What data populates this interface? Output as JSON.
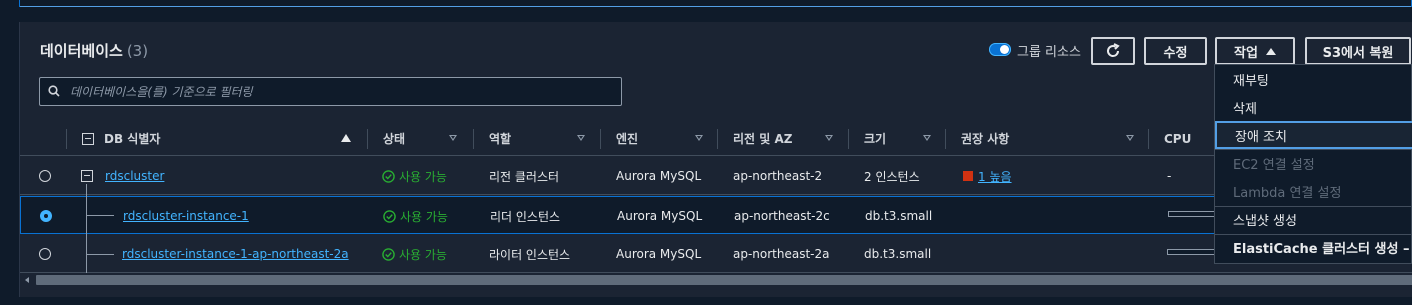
{
  "header": {
    "title": "데이터베이스",
    "count": "(3)",
    "group_toggle_label": "그룹 리소스",
    "group_toggle_on": true,
    "edit_label": "수정",
    "actions_label": "작업",
    "restore_label": "S3에서 복원"
  },
  "filter": {
    "placeholder": "데이터베이스을(를) 기준으로 필터링"
  },
  "columns": {
    "db_id": "DB 식별자",
    "status": "상태",
    "role": "역할",
    "engine": "엔진",
    "region": "리전 및 AZ",
    "size": "크기",
    "recommendations": "권장 사항",
    "cpu": "CPU"
  },
  "rows": [
    {
      "id": "rdscluster",
      "status": "사용 가능",
      "role": "리전 클러스터",
      "engine": "Aurora MySQL",
      "region": "ap-northeast-2",
      "size": "2 인스턴스",
      "recommendation": "1 높음",
      "cpu": "-",
      "selected": false
    },
    {
      "id": "rdscluster-instance-1",
      "status": "사용 가능",
      "role": "리더 인스턴스",
      "engine": "Aurora MySQL",
      "region": "ap-northeast-2c",
      "size": "db.t3.small",
      "recommendation": "",
      "cpu": "",
      "selected": true
    },
    {
      "id": "rdscluster-instance-1-ap-northeast-2a",
      "status": "사용 가능",
      "role": "라이터 인스턴스",
      "engine": "Aurora MySQL",
      "region": "ap-northeast-2a",
      "size": "db.t3.small",
      "recommendation": "",
      "cpu": "",
      "selected": false
    }
  ],
  "actions_menu": {
    "items": [
      {
        "label": "재부팅",
        "disabled": false
      },
      {
        "label": "삭제",
        "disabled": false
      },
      {
        "label": "장애 조치",
        "disabled": false,
        "focused": true
      },
      {
        "label": "EC2 연결 설정",
        "disabled": true
      },
      {
        "label": "Lambda 연결 설정",
        "disabled": true
      },
      {
        "label": "스냅샷 생성",
        "disabled": false
      },
      {
        "label": "ElastiCache 클러스터 생성 – 신규",
        "disabled": false
      }
    ]
  },
  "colors": {
    "accent": "#0972d3",
    "link": "#42b4ff",
    "success": "#29ad32",
    "severity_high": "#d13212",
    "background": "#0f1b2a",
    "panel": "#1b2433"
  }
}
